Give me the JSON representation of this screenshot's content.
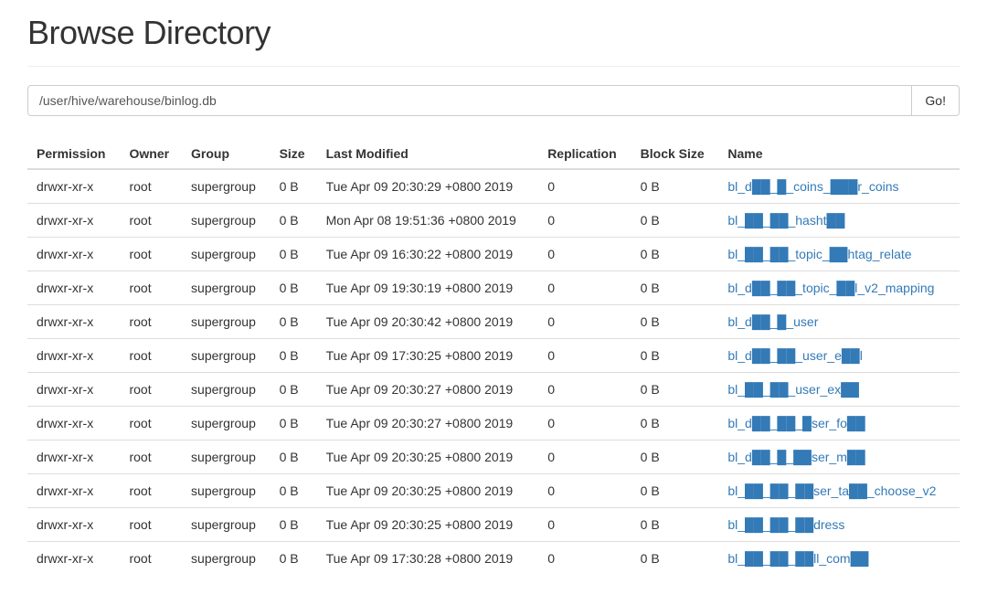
{
  "header": {
    "title": "Browse Directory"
  },
  "path_input": {
    "value": "/user/hive/warehouse/binlog.db",
    "go_label": "Go!"
  },
  "table": {
    "columns": {
      "permission": "Permission",
      "owner": "Owner",
      "group": "Group",
      "size": "Size",
      "last_modified": "Last Modified",
      "replication": "Replication",
      "block_size": "Block Size",
      "name": "Name"
    },
    "rows": [
      {
        "permission": "drwxr-xr-x",
        "owner": "root",
        "group": "supergroup",
        "size": "0 B",
        "last_modified": "Tue Apr 09 20:30:29 +0800 2019",
        "replication": "0",
        "block_size": "0 B",
        "name": "bl_d██_█_coins_███r_coins"
      },
      {
        "permission": "drwxr-xr-x",
        "owner": "root",
        "group": "supergroup",
        "size": "0 B",
        "last_modified": "Mon Apr 08 19:51:36 +0800 2019",
        "replication": "0",
        "block_size": "0 B",
        "name": "bl_██_██_hasht██"
      },
      {
        "permission": "drwxr-xr-x",
        "owner": "root",
        "group": "supergroup",
        "size": "0 B",
        "last_modified": "Tue Apr 09 16:30:22 +0800 2019",
        "replication": "0",
        "block_size": "0 B",
        "name": "bl_██_██_topic_██htag_relate"
      },
      {
        "permission": "drwxr-xr-x",
        "owner": "root",
        "group": "supergroup",
        "size": "0 B",
        "last_modified": "Tue Apr 09 19:30:19 +0800 2019",
        "replication": "0",
        "block_size": "0 B",
        "name": "bl_d██_██_topic_██l_v2_mapping"
      },
      {
        "permission": "drwxr-xr-x",
        "owner": "root",
        "group": "supergroup",
        "size": "0 B",
        "last_modified": "Tue Apr 09 20:30:42 +0800 2019",
        "replication": "0",
        "block_size": "0 B",
        "name": "bl_d██_█_user"
      },
      {
        "permission": "drwxr-xr-x",
        "owner": "root",
        "group": "supergroup",
        "size": "0 B",
        "last_modified": "Tue Apr 09 17:30:25 +0800 2019",
        "replication": "0",
        "block_size": "0 B",
        "name": "bl_d██_██_user_e██l"
      },
      {
        "permission": "drwxr-xr-x",
        "owner": "root",
        "group": "supergroup",
        "size": "0 B",
        "last_modified": "Tue Apr 09 20:30:27 +0800 2019",
        "replication": "0",
        "block_size": "0 B",
        "name": "bl_██_██_user_ex██"
      },
      {
        "permission": "drwxr-xr-x",
        "owner": "root",
        "group": "supergroup",
        "size": "0 B",
        "last_modified": "Tue Apr 09 20:30:27 +0800 2019",
        "replication": "0",
        "block_size": "0 B",
        "name": "bl_d██_██_█ser_fo██"
      },
      {
        "permission": "drwxr-xr-x",
        "owner": "root",
        "group": "supergroup",
        "size": "0 B",
        "last_modified": "Tue Apr 09 20:30:25 +0800 2019",
        "replication": "0",
        "block_size": "0 B",
        "name": "bl_d██_█_██ser_m██"
      },
      {
        "permission": "drwxr-xr-x",
        "owner": "root",
        "group": "supergroup",
        "size": "0 B",
        "last_modified": "Tue Apr 09 20:30:25 +0800 2019",
        "replication": "0",
        "block_size": "0 B",
        "name": "bl_██_██_██ser_ta██_choose_v2"
      },
      {
        "permission": "drwxr-xr-x",
        "owner": "root",
        "group": "supergroup",
        "size": "0 B",
        "last_modified": "Tue Apr 09 20:30:25 +0800 2019",
        "replication": "0",
        "block_size": "0 B",
        "name": "bl_██_██_██dress"
      },
      {
        "permission": "drwxr-xr-x",
        "owner": "root",
        "group": "supergroup",
        "size": "0 B",
        "last_modified": "Tue Apr 09 17:30:28 +0800 2019",
        "replication": "0",
        "block_size": "0 B",
        "name": "bl_██_██_██ll_com██"
      }
    ]
  }
}
